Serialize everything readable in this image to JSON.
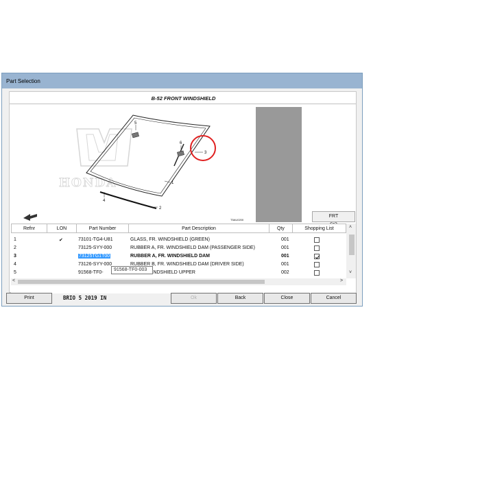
{
  "window": {
    "title": "Part Selection"
  },
  "diagram": {
    "title": "B-52 FRONT WINDSHIELD",
    "brand": "HONDA",
    "callouts": [
      "1",
      "2",
      "3",
      "4",
      "5",
      "6"
    ],
    "code": "T5AU0200",
    "highlight_color": "#e02020"
  },
  "zoom": {
    "zoom_in_icon": "zoom-in-icon",
    "zoom_fit_icon": "zoom-fit-icon",
    "zoom_out_icon": "zoom-out-icon"
  },
  "frt_button": "FRT",
  "table": {
    "columns": [
      "Refnr",
      "LON",
      "Part Number",
      "Part Description",
      "Qty",
      "Shopping List"
    ],
    "rows": [
      {
        "refnr": "1",
        "lon": "✔",
        "part_number": "73101-TG4-U81",
        "description": "GLASS, FR. WINDSHIELD (GREEN)",
        "qty": "001",
        "checked": false
      },
      {
        "refnr": "2",
        "lon": "",
        "part_number": "73125-SYY-000",
        "description": "RUBBER A, FR. WINDSHIELD DAM (PASSENGER SIDE)",
        "qty": "001",
        "checked": false
      },
      {
        "refnr": "3",
        "lon": "",
        "part_number": "73125TG1T00",
        "description": "RUBBER A, FR. WINDSHIELD DAM",
        "qty": "001",
        "checked": true
      },
      {
        "refnr": "4",
        "lon": "",
        "part_number": "73126-SYY-000",
        "description": "RUBBER B, FR. WINDSHIELD DAM (DRIVER SIDE)",
        "qty": "001",
        "checked": false
      },
      {
        "refnr": "5",
        "lon": "",
        "part_number": "91568-TF0-",
        "description": ", WINDSHIELD UPPER",
        "qty": "002",
        "checked": false
      }
    ],
    "tooltip": "91568-TF0-003"
  },
  "footer": {
    "print": "Print",
    "vehicle": "BRIO  5  2019  IN",
    "ok": "Ok",
    "back": "Back",
    "close": "Close",
    "cancel": "Cancel"
  }
}
